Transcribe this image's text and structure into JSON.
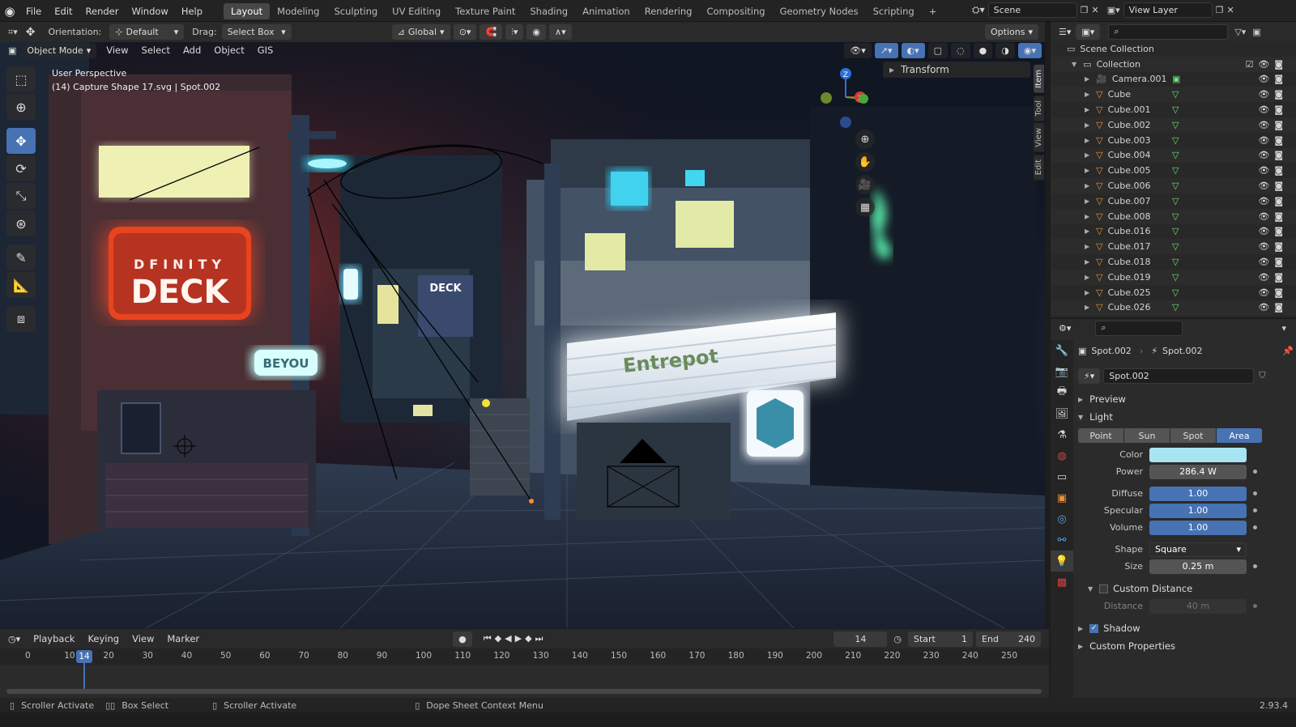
{
  "topbar": {
    "menus": [
      "File",
      "Edit",
      "Render",
      "Window",
      "Help"
    ],
    "workspaces": [
      "Layout",
      "Modeling",
      "Sculpting",
      "UV Editing",
      "Texture Paint",
      "Shading",
      "Animation",
      "Rendering",
      "Compositing",
      "Geometry Nodes",
      "Scripting"
    ],
    "active_workspace": "Layout",
    "add_tab": "+",
    "scene_label": "Scene",
    "view_layer_label": "View Layer"
  },
  "header": {
    "orientation_label": "Orientation:",
    "orientation_value": "Default",
    "drag_label": "Drag:",
    "drag_value": "Select Box",
    "transform_orientation": "Global",
    "options_label": "Options"
  },
  "viewport_header": {
    "mode": "Object Mode",
    "menus": [
      "View",
      "Select",
      "Add",
      "Object",
      "GIS"
    ]
  },
  "viewport": {
    "perspective": "User Perspective",
    "info": "(14) Capture Shape 17.svg | Spot.002",
    "transform_panel": "Transform",
    "side_tabs": [
      "Item",
      "Tool",
      "View",
      "Edit"
    ],
    "active_side_tab": "Item",
    "scene_texts": {
      "sign_top": "DFINITY",
      "sign_main": "DECK",
      "sign_beyou": "BEYOU",
      "sign_store": "Entrepot",
      "poster": "DECK"
    }
  },
  "timeline": {
    "menus": [
      "Playback",
      "Keying",
      "View",
      "Marker"
    ],
    "current_frame": "14",
    "start_label": "Start",
    "start_value": "1",
    "end_label": "End",
    "end_value": "240",
    "ticks": [
      "0",
      "10",
      "20",
      "30",
      "40",
      "50",
      "60",
      "70",
      "80",
      "90",
      "100",
      "110",
      "120",
      "130",
      "140",
      "150",
      "160",
      "170",
      "180",
      "190",
      "200",
      "210",
      "220",
      "230",
      "240",
      "250"
    ]
  },
  "statusbar": {
    "items": [
      "Scroller Activate",
      "Box Select",
      "Scroller Activate",
      "Dope Sheet Context Menu"
    ],
    "version": "2.93.4"
  },
  "outliner": {
    "root": "Scene Collection",
    "collection": "Collection",
    "items": [
      "Camera.001",
      "Cube",
      "Cube.001",
      "Cube.002",
      "Cube.003",
      "Cube.004",
      "Cube.005",
      "Cube.006",
      "Cube.007",
      "Cube.008",
      "Cube.016",
      "Cube.017",
      "Cube.018",
      "Cube.019",
      "Cube.025",
      "Cube.026"
    ]
  },
  "properties": {
    "object_name": "Spot.002",
    "data_name": "Spot.002",
    "datablock": "Spot.002",
    "sections": {
      "preview": "Preview",
      "light": "Light",
      "custom_distance": "Custom Distance",
      "shadow": "Shadow",
      "custom_properties": "Custom Properties"
    },
    "light_types": [
      "Point",
      "Sun",
      "Spot",
      "Area"
    ],
    "active_light_type": "Area",
    "color_label": "Color",
    "color_value": "#a9e4f3",
    "power_label": "Power",
    "power_value": "286.4 W",
    "diffuse_label": "Diffuse",
    "diffuse_value": "1.00",
    "specular_label": "Specular",
    "specular_value": "1.00",
    "volume_label": "Volume",
    "volume_value": "1.00",
    "shape_label": "Shape",
    "shape_value": "Square",
    "size_label": "Size",
    "size_value": "0.25 m",
    "distance_label": "Distance",
    "distance_value": "40 m"
  },
  "colors": {
    "accent": "#4772b3",
    "header_bg": "#232323",
    "panel_bg": "#2b2b2b"
  }
}
